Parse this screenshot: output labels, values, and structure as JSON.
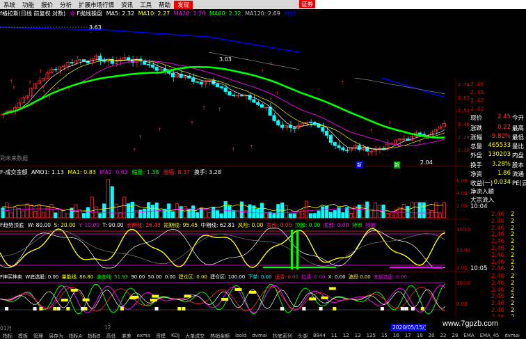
{
  "menu": {
    "items": [
      "系统",
      "功能",
      "报价",
      "分析",
      "扩展市场行情",
      "资讯",
      "工具",
      "帮助"
    ],
    "active": "发现",
    "right_label": "证券"
  },
  "main_title": {
    "stock": "f格拉斯(日线 前复权 对数)",
    "indicator": "F抛线操盘",
    "ma5": "MA5: 2.32",
    "ma10": "MA10: 2.27",
    "ma20": "MA20: 2.20",
    "ma60": "MA60: 2.32",
    "ma120": "MA120: 2.69",
    "ma_extra": "MA2"
  },
  "chart_labels": {
    "high_mark": "3.63",
    "mid_mark": "3.03",
    "low_mark": "2.04",
    "future": "到未来数据",
    "xin": "新",
    "xin2": "新"
  },
  "price_axis": [
    "2.74",
    "2.62",
    "2.51",
    "2.40",
    "2.29",
    "2.18"
  ],
  "vol_title": {
    "name": "F-成交金额",
    "amo1": "AMO1: 1.13",
    "ma1": "MA1: 0.83",
    "ma2": "MA2: 0.62",
    "shrink": "缩量: 1.38",
    "up": "涨幅: 8.37",
    "turnover": "换手: 3.28"
  },
  "vol_axis": [
    "6.00",
    "4.00",
    "2.00"
  ],
  "trend_title": {
    "name": "F趋势顶底",
    "v": "W: 80.00",
    "s": "S: 20.00",
    "y": "Y: 10.00",
    "t": "T: 90.00",
    "long": "长期线: 26.43",
    "short": "短期线: 95.45",
    "mid": "中期线: 62.81",
    "risk": "风险: 0.00",
    "sell": "卖出: 0.00",
    "top": "顶部: 0.00",
    "bottom": "底部: 0.00",
    "hold": "持币",
    "hold2": "持股"
  },
  "trend_axis": [
    "100.0",
    "50.00",
    "0.00"
  ],
  "buy_title": {
    "name": "F神买神卖",
    "w": "W底选股: 0.00",
    "dev": "量能线: 86.80",
    "speed": "速度线: 51.93",
    "v90": "90.00",
    "v50": "50.00",
    "v0": "0.00",
    "build": "建仓区: 0.00",
    "buildline": "建仓区: 100.00",
    "sell": "下单: 0.00",
    "out": "出清: 0.00",
    "ask": "拉清: 0.00",
    "x": "X: 0.00",
    "wave": "波段 0.00",
    "pick": "底部选股: 0.00"
  },
  "buy_axis": [
    "100.0",
    "0.00"
  ],
  "right_panel": {
    "prices_top": [
      "2.45",
      "2.45",
      "2.42",
      "2.42"
    ],
    "rows": [
      {
        "label": "现价",
        "value": "2.45",
        "suffix": "今开"
      },
      {
        "label": "涨跌",
        "value": "0.22",
        "suffix": "最高"
      },
      {
        "label": "涨幅",
        "value": "9.82%",
        "suffix": "最低"
      },
      {
        "label": "总量",
        "value": "465533",
        "suffix": "量比"
      },
      {
        "label": "外盘",
        "value": "130203",
        "suffix": "内盘"
      },
      {
        "label": "换手",
        "value": "3.28%",
        "suffix": "股本"
      },
      {
        "label": "净资",
        "value": "1.86",
        "suffix": "流通"
      },
      {
        "label": "收益(一)",
        "value": "0.034",
        "suffix": "PE(云"
      },
      {
        "label": "净流入额",
        "value": "",
        "suffix": ""
      },
      {
        "label": "大宗流入",
        "value": "",
        "suffix": ""
      }
    ],
    "time1": "10:04",
    "ticks1": [
      {
        "p": "2.46",
        "q": "2"
      },
      {
        "p": "2.46",
        "q": "2"
      },
      {
        "p": "2.46",
        "q": "2"
      },
      {
        "p": "2.46",
        "q": "2"
      },
      {
        "p": "2.46",
        "q": "2"
      },
      {
        "p": "2.46",
        "q": "2"
      },
      {
        "p": "2.46",
        "q": "2"
      },
      {
        "p": "2.46",
        "q": "2"
      },
      {
        "p": "2.46",
        "q": "2"
      }
    ],
    "time2": "10:05",
    "ticks2": [
      {
        "p": "2.46",
        "q": "2"
      },
      {
        "p": "2.46",
        "q": "2"
      },
      {
        "p": "2.46",
        "q": "2"
      },
      {
        "p": "2.46",
        "q": "2"
      },
      {
        "p": "2.46",
        "q": "2"
      },
      {
        "p": "2.46",
        "q": "2"
      },
      {
        "p": "2.46",
        "q": "2"
      },
      {
        "p": "2.46",
        "q": "2"
      },
      {
        "p": "2.46",
        "q": "2"
      }
    ]
  },
  "date_axis": {
    "left": "01月",
    "mid": "12",
    "date": "2020/05/15/五"
  },
  "bottom_tabs": [
    "指标",
    "模板",
    "管理",
    "另存为",
    "指标A",
    "指标B",
    "高低",
    "准差",
    "exma",
    "资模",
    "KDJ",
    "大单成交",
    "热销金额",
    "lsold",
    "dvmai",
    "抄底系列",
    "头湖",
    "8844",
    "11",
    "12",
    "13",
    "135",
    "15",
    "16",
    "17",
    "18",
    "20",
    "22",
    "28",
    "EMA",
    "EMA_45",
    "dvmai"
  ],
  "watermark": "www.7gpzb.com",
  "colors": {
    "up": "#ff3030",
    "down": "#00ffff",
    "ma_green": "#00ff00",
    "ma_blue": "#0000ff",
    "ma_magenta": "#ff00ff",
    "ma_yellow": "#ffff00",
    "ma_white": "#ffffff"
  }
}
